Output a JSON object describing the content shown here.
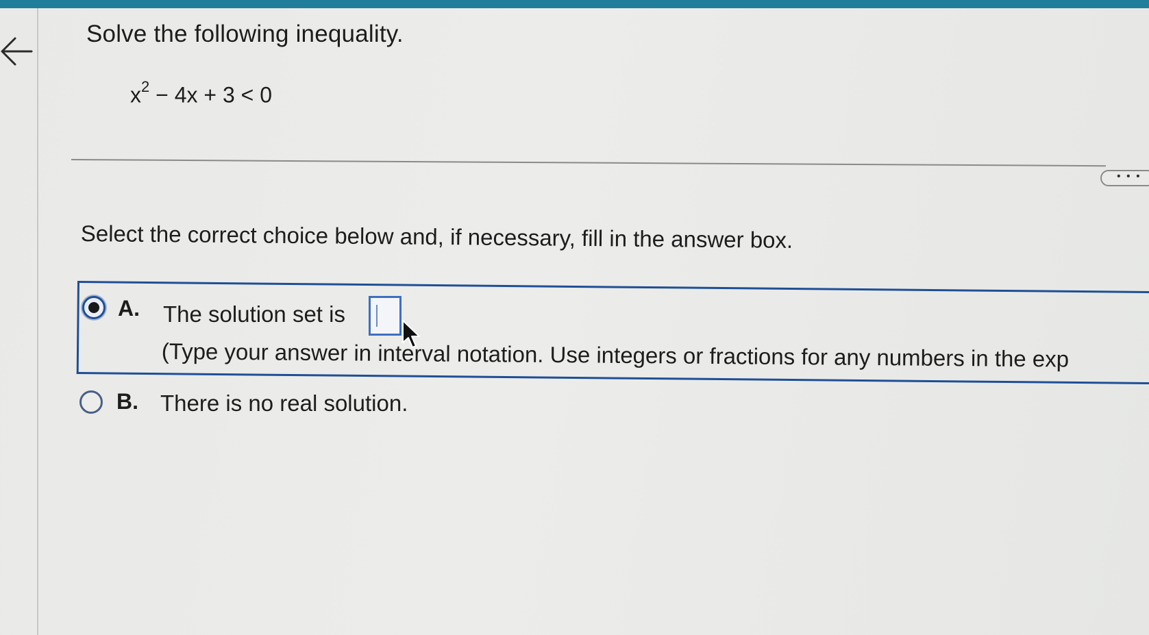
{
  "header": {
    "back_icon": "arrow-left-icon",
    "accent_color": "#1f7f9a"
  },
  "question": {
    "title": "Solve the following inequality.",
    "equation": {
      "base": "x",
      "exponent": "2",
      "rest": "− 4x + 3 < 0"
    }
  },
  "more_button": {
    "label": "• • •"
  },
  "instructions": "Select the correct choice below and, if necessary, fill in the answer box.",
  "choices": [
    {
      "letter": "A.",
      "text": "The solution set is",
      "hint": "(Type your answer in interval notation. Use integers or fractions for any numbers in the exp",
      "selected": true,
      "answer_value": ""
    },
    {
      "letter": "B.",
      "text": "There is no real solution.",
      "selected": false
    }
  ],
  "colors": {
    "selection_border": "#1f4f96",
    "input_border": "#3d6fc0"
  }
}
